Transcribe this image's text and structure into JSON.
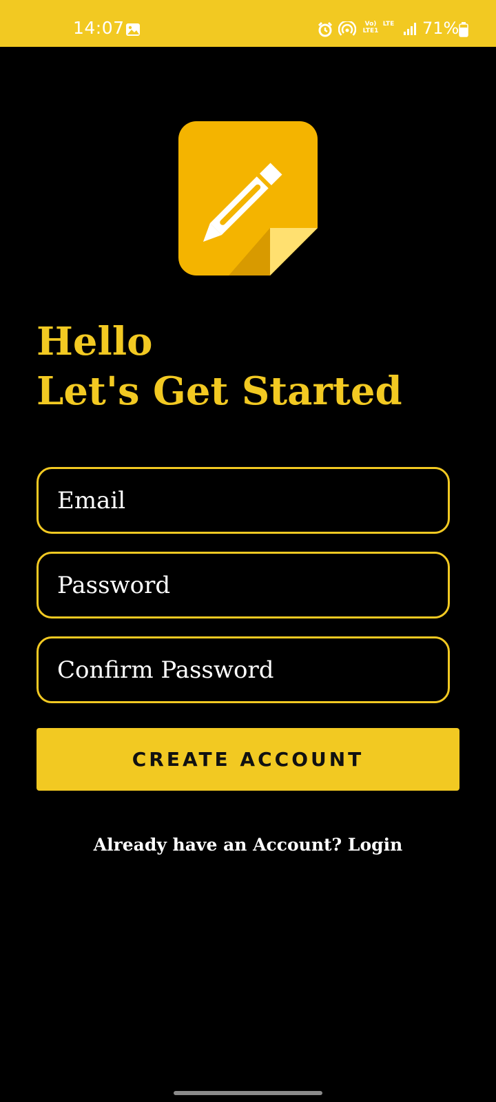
{
  "status_bar": {
    "time": "14:07",
    "volte_label": "Vo) LTE1",
    "lte_label": "LTE",
    "battery_percent": "71%",
    "background_color": "#F2C922",
    "icons": [
      "gallery-icon",
      "alarm-icon",
      "hotspot-icon",
      "signal-icon",
      "battery-icon"
    ]
  },
  "logo": {
    "icon": "notepad-pencil-icon",
    "color": "#F4B400"
  },
  "greeting": {
    "line1": "Hello",
    "line2": "Let's Get Started",
    "color": "#F2C922"
  },
  "form": {
    "email_placeholder": "Email",
    "password_placeholder": "Password",
    "confirm_password_placeholder": "Confirm Password",
    "email_value": "",
    "password_value": "",
    "confirm_password_value": ""
  },
  "create_button": {
    "label": "CREATE ACCOUNT"
  },
  "login_link": {
    "text": "Already have an Account? Login"
  }
}
